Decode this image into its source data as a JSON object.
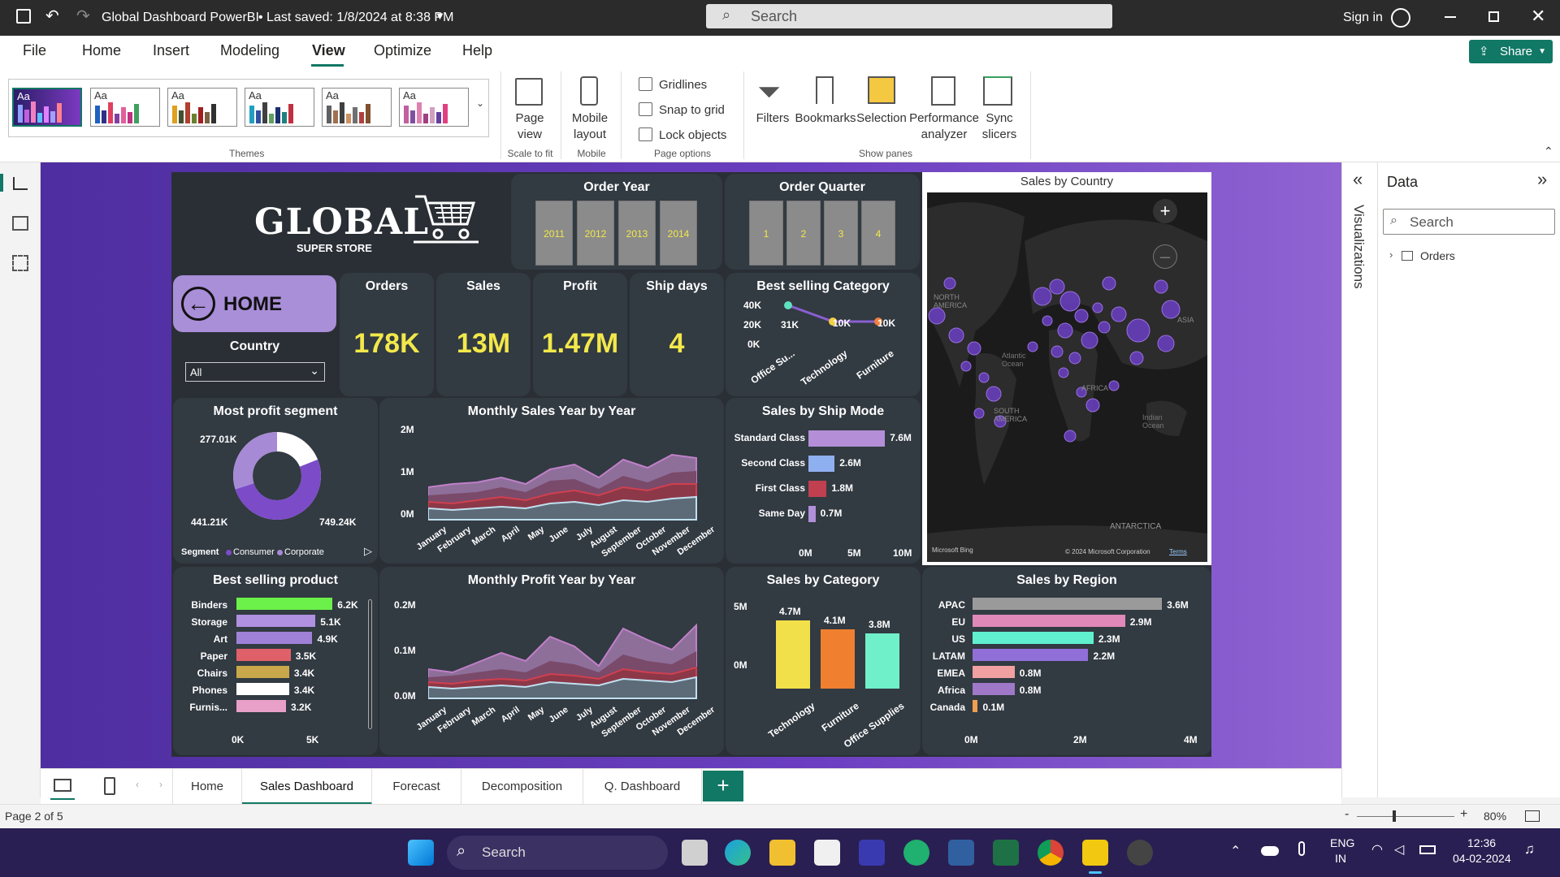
{
  "titlebar": {
    "title": "Global Dashboard PowerBI",
    "saved": "• Last saved: 1/8/2024 at 8:38 PM",
    "search_placeholder": "Search",
    "signin": "Sign in"
  },
  "menu": [
    "File",
    "Home",
    "Insert",
    "Modeling",
    "View",
    "Optimize",
    "Help"
  ],
  "share_label": "Share",
  "ribbon": {
    "themes_label": "Themes",
    "page_view": "Page view",
    "scale_to_fit": "Scale to fit",
    "mobile_layout": "Mobile layout",
    "mobile": "Mobile",
    "gridlines": "Gridlines",
    "snap_to_grid": "Snap to grid",
    "lock_objects": "Lock objects",
    "page_options": "Page options",
    "filters": "Filters",
    "bookmarks": "Bookmarks",
    "selection": "Selection",
    "performance": "Performance analyzer",
    "sync_slicers": "Sync slicers",
    "show_panes": "Show panes"
  },
  "report": {
    "logo_text": "GLOBAL",
    "logo_sub": "SUPER STORE",
    "home_label": "HOME",
    "country_label": "Country",
    "country_value": "All",
    "order_year_title": "Order Year",
    "years": [
      "2011",
      "2012",
      "2013",
      "2014"
    ],
    "order_quarter_title": "Order Quarter",
    "quarters": [
      "1",
      "2",
      "3",
      "4"
    ],
    "kpis": [
      {
        "title": "Orders",
        "value": "178K"
      },
      {
        "title": "Sales",
        "value": "13M"
      },
      {
        "title": "Profit",
        "value": "1.47M"
      },
      {
        "title": "Ship days",
        "value": "4"
      }
    ],
    "map_title": "Sales by Country",
    "map_labels": {
      "na": "NORTH AMERICA",
      "atl": "Atlantic Ocean",
      "sa": "SOUTH AMERICA",
      "asia": "ASIA",
      "afr": "AFRICA",
      "ind": "Indian Ocean",
      "ant": "ANTARCTICA",
      "bing": "Microsoft Bing",
      "copy": "© 2024 Microsoft Corporation",
      "terms": "Terms"
    }
  },
  "chart_data": [
    {
      "type": "line",
      "title": "Best selling Category",
      "categories": [
        "Office Su...",
        "Technology",
        "Furniture"
      ],
      "values_labels": [
        "31K",
        "10K",
        "10K"
      ],
      "yticks": [
        "40K",
        "20K",
        "0K"
      ]
    },
    {
      "type": "pie",
      "title": "Most profit segment",
      "labels": [
        "277.01K",
        "441.21K",
        "749.24K"
      ],
      "values": [
        277.01,
        441.21,
        749.24
      ],
      "legend_title": "Segment",
      "legend": [
        "Consumer",
        "Corporate"
      ]
    },
    {
      "type": "area",
      "title": "Monthly Sales Year by Year",
      "yticks": [
        "2M",
        "1M",
        "0M"
      ],
      "categories": [
        "January",
        "February",
        "March",
        "April",
        "May",
        "June",
        "July",
        "August",
        "September",
        "October",
        "November",
        "December"
      ]
    },
    {
      "type": "bar",
      "title": "Sales by Ship Mode",
      "categories": [
        "Standard Class",
        "Second Class",
        "First Class",
        "Same Day"
      ],
      "values": [
        7.6,
        2.6,
        1.8,
        0.7
      ],
      "value_labels": [
        "7.6M",
        "2.6M",
        "1.8M",
        "0.7M"
      ],
      "xticks": [
        "0M",
        "5M",
        "10M"
      ],
      "colors": [
        "#b48fd8",
        "#8fb0f0",
        "#c04050",
        "#b090d8"
      ]
    },
    {
      "type": "bar",
      "title": "Best selling product",
      "categories": [
        "Binders",
        "Storage",
        "Art",
        "Paper",
        "Chairs",
        "Phones",
        "Furnis..."
      ],
      "values": [
        6.2,
        5.1,
        4.9,
        3.5,
        3.4,
        3.4,
        3.2
      ],
      "value_labels": [
        "6.2K",
        "5.1K",
        "4.9K",
        "3.5K",
        "3.4K",
        "3.4K",
        "3.2K"
      ],
      "xticks": [
        "0K",
        "5K"
      ],
      "colors": [
        "#6cf04a",
        "#b090e0",
        "#9f82d8",
        "#e0606a",
        "#c8a84a",
        "#ffffff",
        "#e8a0c8"
      ]
    },
    {
      "type": "area",
      "title": "Monthly Profit Year by Year",
      "yticks": [
        "0.2M",
        "0.1M",
        "0.0M"
      ],
      "categories": [
        "January",
        "February",
        "March",
        "April",
        "May",
        "June",
        "July",
        "August",
        "September",
        "October",
        "November",
        "December"
      ]
    },
    {
      "type": "bar",
      "title": "Sales by Category",
      "categories": [
        "Technology",
        "Furniture",
        "Office Supplies"
      ],
      "values": [
        4.7,
        4.1,
        3.8
      ],
      "value_labels": [
        "4.7M",
        "4.1M",
        "3.8M"
      ],
      "yticks": [
        "5M",
        "0M"
      ],
      "colors": [
        "#f2e04a",
        "#f08030",
        "#70f0c8"
      ]
    },
    {
      "type": "bar",
      "title": "Sales by Region",
      "categories": [
        "APAC",
        "EU",
        "US",
        "LATAM",
        "EMEA",
        "Africa",
        "Canada"
      ],
      "values": [
        3.6,
        2.9,
        2.3,
        2.2,
        0.8,
        0.8,
        0.1
      ],
      "value_labels": [
        "3.6M",
        "2.9M",
        "2.3M",
        "2.2M",
        "0.8M",
        "0.8M",
        "0.1M"
      ],
      "xticks": [
        "0M",
        "2M",
        "4M"
      ],
      "colors": [
        "#9a9a9a",
        "#e088b8",
        "#60f0d0",
        "#9070d8",
        "#f0a0a0",
        "#a078c8",
        "#f0a050"
      ]
    }
  ],
  "data_pane": {
    "title": "Data",
    "search_placeholder": "Search",
    "table": "Orders",
    "visualizations": "Visualizations"
  },
  "tabs": [
    "Home",
    "Sales Dashboard",
    "Forecast",
    "Decomposition",
    "Q. Dashboard"
  ],
  "status": {
    "page": "Page 2 of 5",
    "zoom": "80%"
  },
  "taskbar": {
    "search": "Search",
    "lang1": "ENG",
    "lang2": "IN",
    "time": "12:36",
    "date": "04-02-2024"
  }
}
